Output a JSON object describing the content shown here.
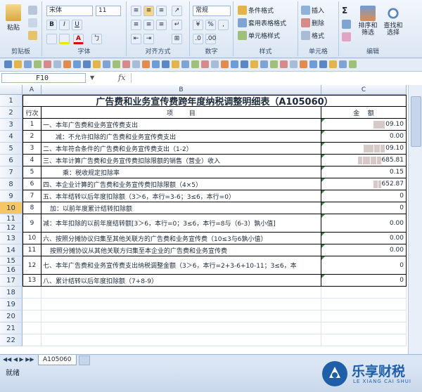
{
  "ribbon": {
    "clipboard": {
      "paste": "粘贴",
      "label": "剪贴板"
    },
    "font": {
      "name": "宋体",
      "size": "11",
      "bold": "B",
      "italic": "I",
      "underline": "U",
      "label": "字体"
    },
    "alignment": {
      "label": "对齐方式"
    },
    "number": {
      "format": "常规",
      "percent": "%",
      "comma": ",",
      "label": "数字"
    },
    "styles": {
      "conditional": "条件格式",
      "table": "套用表格格式",
      "cell": "单元格样式",
      "label": "样式"
    },
    "cells": {
      "insert": "插入",
      "delete": "删除",
      "format": "格式",
      "label": "单元格"
    },
    "editing": {
      "sum": "Σ",
      "sort": "排序和筛选",
      "find": "查找和选择",
      "label": "编辑"
    }
  },
  "formula_bar": {
    "cell_ref": "F10",
    "fx": "fx"
  },
  "columns": [
    "A",
    "B",
    "C"
  ],
  "rows": [
    "1",
    "2",
    "3",
    "4",
    "5",
    "6",
    "7",
    "8",
    "9",
    "10",
    "11",
    "12",
    "13",
    "14",
    "15",
    "16",
    "17",
    "18",
    "19",
    "20",
    "21",
    "22"
  ],
  "table": {
    "title": "广告费和业务宣传费跨年度纳税调整明细表（A105060）",
    "header_seq": "行次",
    "header_item": "项        目",
    "header_amount": "金    额",
    "rows": [
      {
        "seq": "1",
        "item": "一、本年广告费和业务宣传费支出",
        "amount": "09.10"
      },
      {
        "seq": "2",
        "item": "减：不允许扣除的广告费和业务宣传费支出",
        "amount": "0.00"
      },
      {
        "seq": "3",
        "item": "二、本年符合条件的广告费和业务宣传费支出（1-2）",
        "amount": "09.10"
      },
      {
        "seq": "4",
        "item": "三、本年计算广告费和业务宣传费扣除限额的销售（营业）收入",
        "amount": "685.81"
      },
      {
        "seq": "5",
        "item": "乘：税收规定扣除率",
        "amount": "0.15"
      },
      {
        "seq": "6",
        "item": "四、本企业计算的广告费和业务宣传费扣除限额（4×5）",
        "amount": "652.87"
      },
      {
        "seq": "7",
        "item": "五、本年结转以后年度扣除额（3＞6，本行=3-6；3≤6，本行=0）",
        "amount": "0"
      },
      {
        "seq": "8",
        "item": "加：以前年度累计结转扣除额",
        "amount": "0"
      },
      {
        "seq": "9",
        "item": "减：本年扣除的以前年度结转额[3＞6，本行=0；3≤6，本行=8与（6-3）孰小值]",
        "amount": "0.00"
      },
      {
        "seq": "10",
        "item": "六、按照分摊协议归集至其他关联方的广告费和业务宣传费（10≤3与6孰小值）",
        "amount": "0.00"
      },
      {
        "seq": "11",
        "item": "按照分摊协议从其他关联方归集至本企业的广告费和业务宣传费",
        "amount": "0.00"
      },
      {
        "seq": "12",
        "item": "七、本年广告费和业务宣传费支出纳税调整金额（3＞6，本行=2+3-6+10-11；3≤6，本",
        "amount": "0"
      },
      {
        "seq": "13",
        "item": "八、累计结转以后年度扣除额（7+8-9）",
        "amount": "0"
      }
    ]
  },
  "sheet_tab": "A105060",
  "status": "就绪",
  "logo": {
    "cn": "乐享财税",
    "en": "LE XIANG CAI SHUI"
  },
  "colors": {
    "accent": "#2d6bbf",
    "selected_row": "#f7c563",
    "logo_blue": "#1f5fa8"
  }
}
